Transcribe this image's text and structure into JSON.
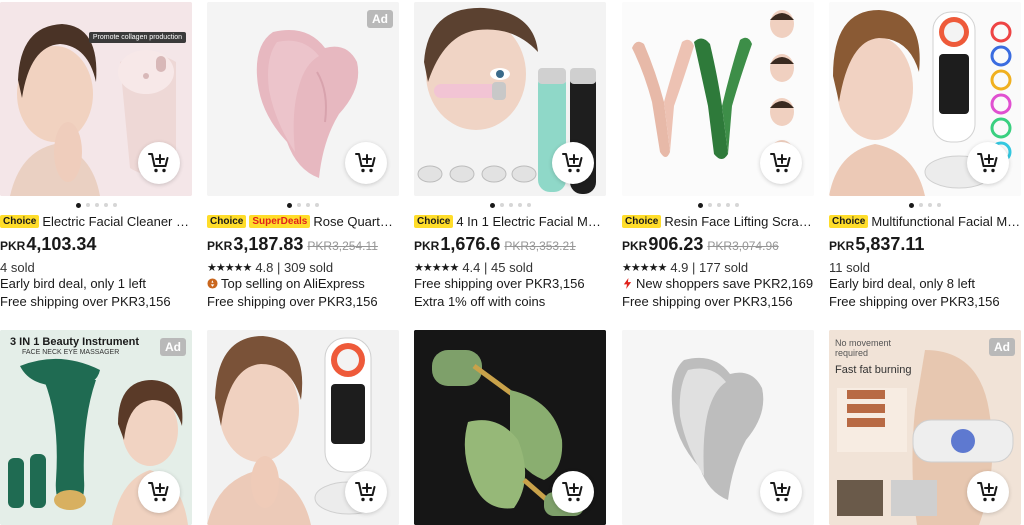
{
  "colors": {
    "accent_red": "#e0221c",
    "choice_yellow": "#ffdd2a",
    "ad_gray": "#b9b9b9"
  },
  "products": [
    {
      "title": "Electric Facial Cleaner Sil...",
      "badges": [
        "Choice"
      ],
      "currency": "PKR",
      "price": "4,103.34",
      "sold": "4 sold",
      "promo": "Early bird deal, only 1 left",
      "shipping": "Free shipping over PKR3,156",
      "image_caption": "Promote collagen production",
      "image_icon": "facial-cleaner-image",
      "dots": 5,
      "active_dot": 0
    },
    {
      "title": "Rose Quartz G...",
      "badges": [
        "Choice",
        "SuperDeals"
      ],
      "currency": "PKR",
      "price": "3,187.83",
      "original_price": "PKR3,254.11",
      "rating": "4.8",
      "sold": "309 sold",
      "promo": "Top selling on AliExpress",
      "shipping": "Free shipping over PKR3,156",
      "ad": "Ad",
      "image_icon": "rose-quartz-gua-sha-image",
      "dots": 4,
      "active_dot": 0
    },
    {
      "title": "4 In 1 Electric Facial Mas...",
      "badges": [
        "Choice"
      ],
      "currency": "PKR",
      "price": "1,676.6",
      "original_price": "PKR3,353.21",
      "rating": "4.4",
      "sold": "45 sold",
      "shipping": "Free shipping over PKR3,156",
      "promo": "Extra 1% off with coins",
      "image_icon": "facial-massager-image",
      "dots": 5,
      "active_dot": 0
    },
    {
      "title": "Resin Face Lifting Scrapi...",
      "badges": [
        "Choice"
      ],
      "currency": "PKR",
      "price": "906.23",
      "original_price": "PKR3,074.96",
      "rating": "4.9",
      "sold": "177 sold",
      "promo": "New shoppers save PKR2,169",
      "shipping": "Free shipping over PKR3,156",
      "image_icon": "face-lifting-roller-image",
      "dots": 5,
      "active_dot": 0
    },
    {
      "title": "Multifunctional Facial Ma...",
      "badges": [
        "Choice"
      ],
      "currency": "PKR",
      "price": "5,837.11",
      "sold": "11 sold",
      "promo": "Early bird deal, only 8 left",
      "shipping": "Free shipping over PKR3,156",
      "image_icon": "facial-beauty-device-image",
      "dots": 4,
      "active_dot": 0
    },
    {
      "ad": "Ad",
      "image_caption": "3 IN 1 Beauty Instrument",
      "image_subcaption": "FACE NECK EYE MASSAGER",
      "image_icon": "beauty-instrument-image"
    },
    {
      "image_icon": "led-facial-device-image"
    },
    {
      "image_icon": "jade-roller-image"
    },
    {
      "image_icon": "steel-gua-sha-image"
    },
    {
      "ad": "Ad",
      "image_caption": "No movement required",
      "image_subcaption": "Fast fat burning",
      "image_icon": "fat-burning-belt-image"
    }
  ],
  "cart_icon": "add-to-cart-icon"
}
